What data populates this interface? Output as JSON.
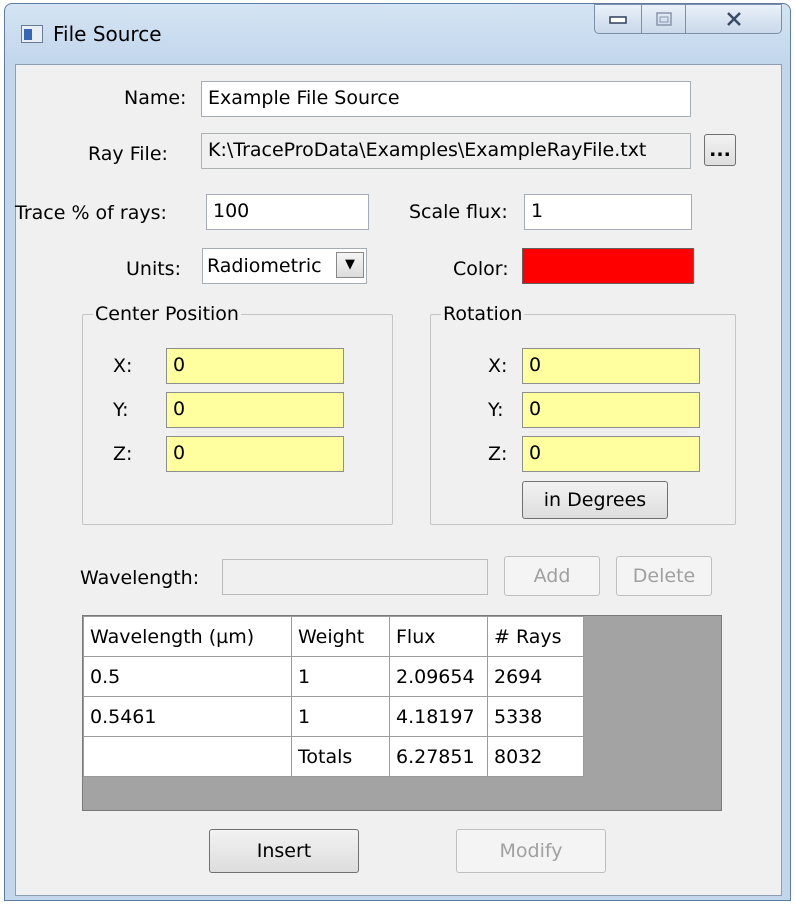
{
  "window": {
    "title": "File Source"
  },
  "form": {
    "name_label": "Name:",
    "name_value": "Example File Source",
    "ray_file_label": "Ray File:",
    "ray_file_value": "K:\\TraceProData\\Examples\\ExampleRayFile.txt",
    "browse_label": "...",
    "trace_label": "Trace % of rays:",
    "trace_value": "100",
    "scale_label": "Scale flux:",
    "scale_value": "1",
    "units_label": "Units:",
    "units_value": "Radiometric",
    "color_label": "Color:",
    "color_value": "#ff0000"
  },
  "center_position": {
    "title": "Center Position",
    "x_label": "X:",
    "x_value": "0",
    "y_label": "Y:",
    "y_value": "0",
    "z_label": "Z:",
    "z_value": "0"
  },
  "rotation": {
    "title": "Rotation",
    "x_label": "X:",
    "x_value": "0",
    "y_label": "Y:",
    "y_value": "0",
    "z_label": "Z:",
    "z_value": "0",
    "degrees_button": "in Degrees"
  },
  "wavelength": {
    "label": "Wavelength:",
    "value": "",
    "add_button": "Add",
    "delete_button": "Delete"
  },
  "table": {
    "headers": [
      "Wavelength (µm)",
      "Weight",
      "Flux",
      "# Rays"
    ],
    "rows": [
      [
        "0.5",
        "1",
        "2.09654",
        "2694"
      ],
      [
        "0.5461",
        "1",
        "4.18197",
        "5338"
      ],
      [
        "",
        "Totals",
        "6.27851",
        "8032"
      ]
    ]
  },
  "buttons": {
    "insert": "Insert",
    "modify": "Modify"
  }
}
